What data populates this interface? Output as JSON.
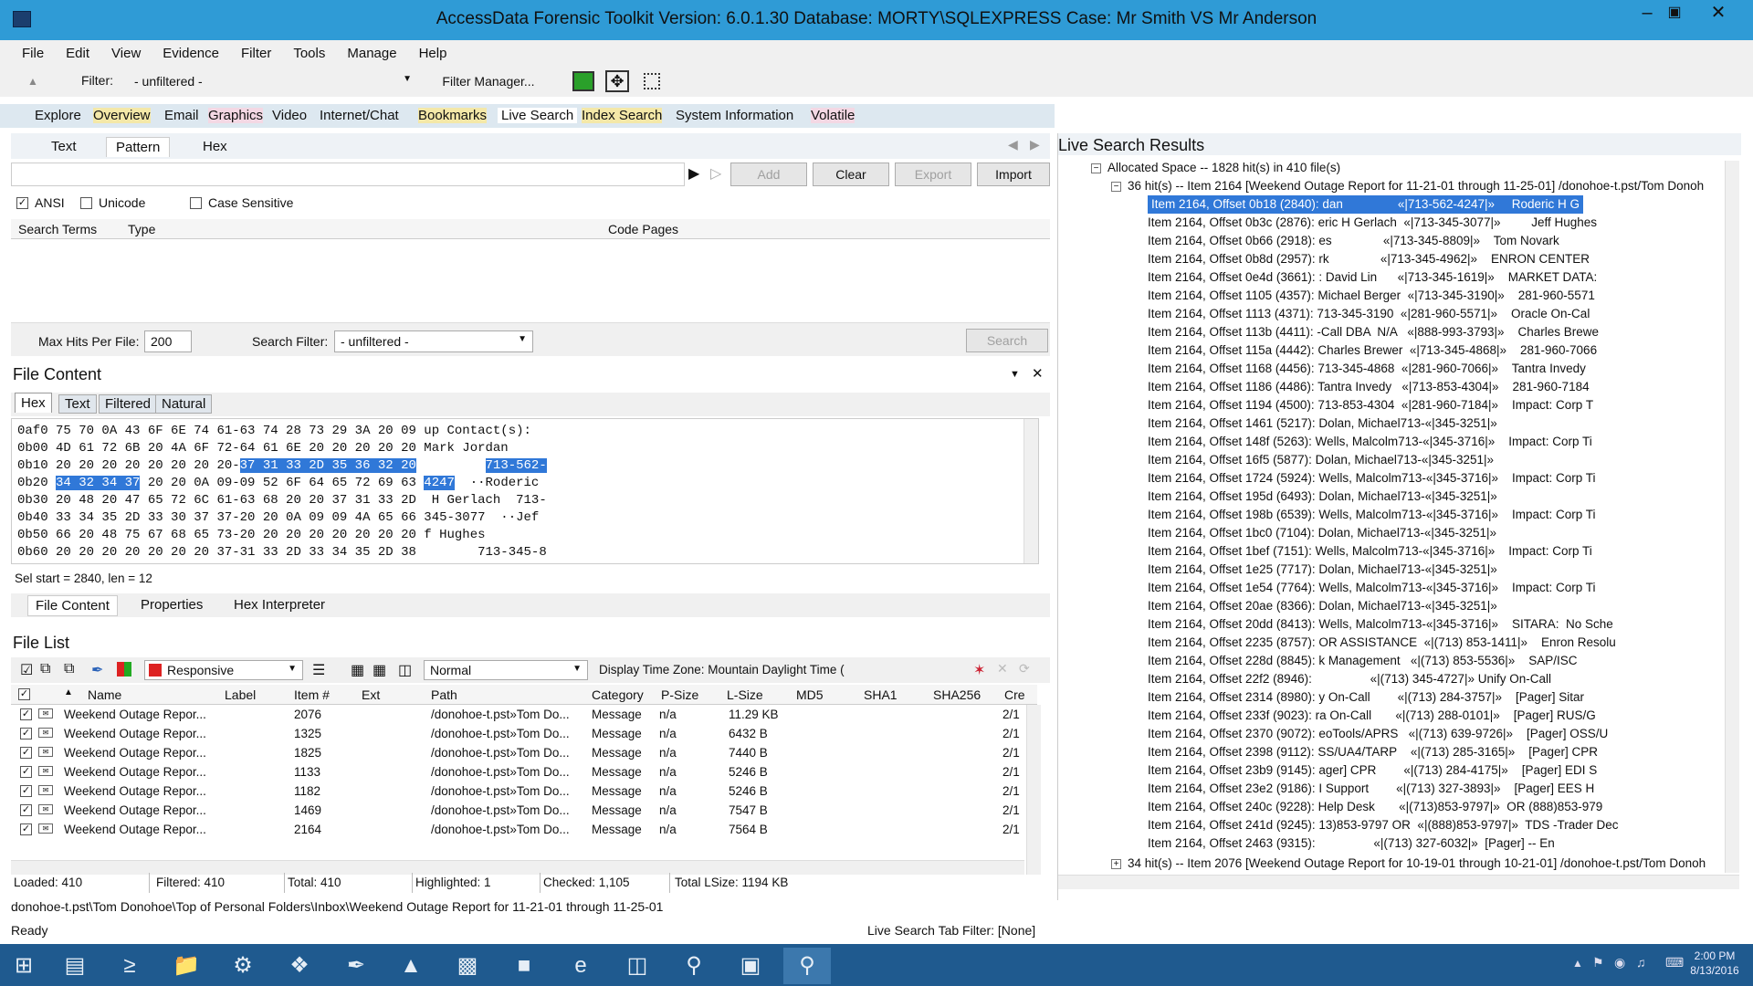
{
  "window": {
    "title": "AccessData Forensic Toolkit Version: 6.0.1.30 Database: MORTY\\SQLEXPRESS Case: Mr Smith VS Mr Anderson"
  },
  "menu": [
    "File",
    "Edit",
    "View",
    "Evidence",
    "Filter",
    "Tools",
    "Manage",
    "Help"
  ],
  "toolbar": {
    "filter_label": "Filter:",
    "filter_value": "- unfiltered -",
    "filter_manager": "Filter Manager..."
  },
  "tabs": [
    "Explore",
    "Overview",
    "Email",
    "Graphics",
    "Video",
    "Internet/Chat",
    "Bookmarks",
    "Live Search",
    "Index Search",
    "System Information",
    "Volatile"
  ],
  "search": {
    "subtabs": [
      "Text",
      "Pattern",
      "Hex"
    ],
    "buttons": {
      "add": "Add",
      "clear": "Clear",
      "export": "Export",
      "import": "Import",
      "search": "Search"
    },
    "options": {
      "ansi": "ANSI",
      "unicode": "Unicode",
      "case": "Case Sensitive"
    },
    "columns": [
      "Search Terms",
      "Type",
      "Code Pages"
    ],
    "max_hits_label": "Max Hits Per File:",
    "max_hits_value": "200",
    "search_filter_label": "Search Filter:",
    "search_filter_value": "- unfiltered -"
  },
  "file_content": {
    "title": "File Content",
    "tabs": [
      "Hex",
      "Text",
      "Filtered",
      "Natural"
    ],
    "hex_rows": [
      {
        "off": "0af0",
        "hex": "75 70 0A 43 6F 6E 74 61-63 74 28 73 29 3A 20 09",
        "txt": "up Contact(s):  "
      },
      {
        "off": "0b00",
        "hex": "4D 61 72 6B 20 4A 6F 72-64 61 6E 20 20 20 20 20",
        "txt": "Mark Jordan     "
      },
      {
        "off": "0b10",
        "hex_a": "20 20 20 20 20 20 20 20-",
        "hex_b": "37 31 33 2D 35 36 32 20",
        "txt_a": "        ",
        "txt_b": "713-562-"
      },
      {
        "off": "0b20",
        "hex_a": "34 32 34 37",
        "hex_b": " 20 20 0A 09-09 52 6F 64 65 72 69 63",
        "txt_a": "4247",
        "txt_b": "  ··Roderic"
      },
      {
        "off": "0b30",
        "hex": "20 48 20 47 65 72 6C 61-63 68 20 20 37 31 33 2D",
        "txt": " H Gerlach  713-"
      },
      {
        "off": "0b40",
        "hex": "33 34 35 2D 33 30 37 37-20 20 0A 09 09 4A 65 66",
        "txt": "345-3077  ··Jef"
      },
      {
        "off": "0b50",
        "hex": "66 20 48 75 67 68 65 73-20 20 20 20 20 20 20 20",
        "txt": "f Hughes        "
      },
      {
        "off": "0b60",
        "hex": "20 20 20 20 20 20 20 37-31 33 2D 33 34 35 2D 38",
        "txt": "       713-345-8"
      }
    ],
    "sel_info": "Sel start = 2840, len = 12",
    "bottom_tabs": [
      "File Content",
      "Properties",
      "Hex Interpreter"
    ]
  },
  "file_list": {
    "title": "File List",
    "view_mode": "Responsive",
    "display_mode": "Normal",
    "timezone": "Display Time Zone: Mountain Daylight Time (",
    "columns": [
      "Name",
      "Label",
      "Item #",
      "Ext",
      "Path",
      "Category",
      "P-Size",
      "L-Size",
      "MD5",
      "SHA1",
      "SHA256",
      "Cre"
    ],
    "rows": [
      {
        "name": "Weekend Outage Repor...",
        "item": "2076",
        "path": "/donohoe-t.pst»Tom Do...",
        "cat": "Message",
        "psize": "n/a",
        "lsize": "11.29 KB",
        "cre": "2/1"
      },
      {
        "name": "Weekend Outage Repor...",
        "item": "1325",
        "path": "/donohoe-t.pst»Tom Do...",
        "cat": "Message",
        "psize": "n/a",
        "lsize": "6432 B",
        "cre": "2/1"
      },
      {
        "name": "Weekend Outage Repor...",
        "item": "1825",
        "path": "/donohoe-t.pst»Tom Do...",
        "cat": "Message",
        "psize": "n/a",
        "lsize": "7440 B",
        "cre": "2/1"
      },
      {
        "name": "Weekend Outage Repor...",
        "item": "1133",
        "path": "/donohoe-t.pst»Tom Do...",
        "cat": "Message",
        "psize": "n/a",
        "lsize": "5246 B",
        "cre": "2/1"
      },
      {
        "name": "Weekend Outage Repor...",
        "item": "1182",
        "path": "/donohoe-t.pst»Tom Do...",
        "cat": "Message",
        "psize": "n/a",
        "lsize": "5246 B",
        "cre": "2/1"
      },
      {
        "name": "Weekend Outage Repor...",
        "item": "1469",
        "path": "/donohoe-t.pst»Tom Do...",
        "cat": "Message",
        "psize": "n/a",
        "lsize": "7547 B",
        "cre": "2/1"
      },
      {
        "name": "Weekend Outage Repor...",
        "item": "2164",
        "path": "/donohoe-t.pst»Tom Do...",
        "cat": "Message",
        "psize": "n/a",
        "lsize": "7564 B",
        "cre": "2/1"
      }
    ],
    "status": {
      "loaded": "Loaded: 410",
      "filtered": "Filtered: 410",
      "total": "Total: 410",
      "highlighted": "Highlighted: 1",
      "checked": "Checked: 1,105",
      "total_lsize": "Total LSize: 1194 KB"
    }
  },
  "live_results": {
    "title": "Live Search Results",
    "root": "Allocated Space -- 1828 hit(s) in 410 file(s)",
    "group1": "36 hit(s) -- Item 2164 [Weekend Outage Report for 11-21-01 through 11-25-01] /donohoe-t.pst/Tom Donoh",
    "hits": [
      "Item 2164, Offset 0b18 (2840): dan                «|713-562-4247|»     Roderic H G",
      "Item 2164, Offset 0b3c (2876): eric H Gerlach  «|713-345-3077|»         Jeff Hughes",
      "Item 2164, Offset 0b66 (2918): es               «|713-345-8809|»    Tom Novark",
      "Item 2164, Offset 0b8d (2957): rk               «|713-345-4962|»    ENRON CENTER",
      "Item 2164, Offset 0e4d (3661): : David Lin      «|713-345-1619|»    MARKET DATA:",
      "Item 2164, Offset 1105 (4357): Michael Berger  «|713-345-3190|»    281-960-5571",
      "Item 2164, Offset 1113 (4371): 713-345-3190  «|281-960-5571|»    Oracle On-Cal",
      "Item 2164, Offset 113b (4411): -Call DBA  N/A   «|888-993-3793|»    Charles Brewe",
      "Item 2164, Offset 115a (4442): Charles Brewer  «|713-345-4868|»    281-960-7066",
      "Item 2164, Offset 1168 (4456): 713-345-4868  «|281-960-7066|»    Tantra Invedy",
      "Item 2164, Offset 1186 (4486): Tantra Invedy   «|713-853-4304|»    281-960-7184",
      "Item 2164, Offset 1194 (4500): 713-853-4304  «|281-960-7184|»    Impact: Corp T",
      "Item 2164, Offset 1461 (5217): Dolan, Michael713-«|345-3251|»",
      "Item 2164, Offset 148f (5263): Wells, Malcolm713-«|345-3716|»    Impact: Corp Ti",
      "Item 2164, Offset 16f5 (5877): Dolan, Michael713-«|345-3251|»",
      "Item 2164, Offset 1724 (5924): Wells, Malcolm713-«|345-3716|»    Impact: Corp Ti",
      "Item 2164, Offset 195d (6493): Dolan, Michael713-«|345-3251|»",
      "Item 2164, Offset 198b (6539): Wells, Malcolm713-«|345-3716|»    Impact: Corp Ti",
      "Item 2164, Offset 1bc0 (7104): Dolan, Michael713-«|345-3251|»",
      "Item 2164, Offset 1bef (7151): Wells, Malcolm713-«|345-3716|»    Impact: Corp Ti",
      "Item 2164, Offset 1e25 (7717): Dolan, Michael713-«|345-3251|»",
      "Item 2164, Offset 1e54 (7764): Wells, Malcolm713-«|345-3716|»    Impact: Corp Ti",
      "Item 2164, Offset 20ae (8366): Dolan, Michael713-«|345-3251|»",
      "Item 2164, Offset 20dd (8413): Wells, Malcolm713-«|345-3716|»    SITARA:  No Sche",
      "Item 2164, Offset 2235 (8757): OR ASSISTANCE  «|(713) 853-1411|»    Enron Resolu",
      "Item 2164, Offset 228d (8845): k Management   «|(713) 853-5536|»    SAP/ISC",
      "Item 2164, Offset 22f2 (8946):                 «|(713) 345-4727|» Unify On-Call",
      "Item 2164, Offset 2314 (8980): y On-Call        «|(713) 284-3757|»    [Pager] Sitar",
      "Item 2164, Offset 233f (9023): ra On-Call       «|(713) 288-0101|»    [Pager] RUS/G",
      "Item 2164, Offset 2370 (9072): eoTools/APRS   «|(713) 639-9726|»    [Pager] OSS/U",
      "Item 2164, Offset 2398 (9112): SS/UA4/TARP    «|(713) 285-3165|»    [Pager] CPR",
      "Item 2164, Offset 23b9 (9145): ager] CPR        «|(713) 284-4175|»    [Pager] EDI S",
      "Item 2164, Offset 23e2 (9186): I Support        «|(713) 327-3893|»    [Pager] EES H",
      "Item 2164, Offset 240c (9228): Help Desk       «|(713)853-9797|»  OR (888)853-979",
      "Item 2164, Offset 241d (9245): 13)853-9797 OR  «|(888)853-9797|»  TDS -Trader Dec",
      "Item 2164, Offset 2463 (9315):                 «|(713) 327-6032|»  [Pager] -- En"
    ],
    "group2": "34 hit(s) -- Item 2076 [Weekend Outage Report for 10-19-01 through 10-21-01] /donohoe-t.pst/Tom Donoh"
  },
  "statusbar": {
    "path": "donohoe-t.pst\\Tom Donohoe\\Top of Personal Folders\\Inbox\\Weekend Outage Report for 11-21-01 through 11-25-01",
    "ready": "Ready",
    "tab_filter": "Live Search Tab Filter: [None]"
  },
  "taskbar": {
    "time": "2:00 PM",
    "date": "8/13/2016"
  },
  "colors": {
    "titlebar": "#2f9bd6",
    "selection": "#3078d8",
    "taskbar": "#1f5a8f"
  }
}
